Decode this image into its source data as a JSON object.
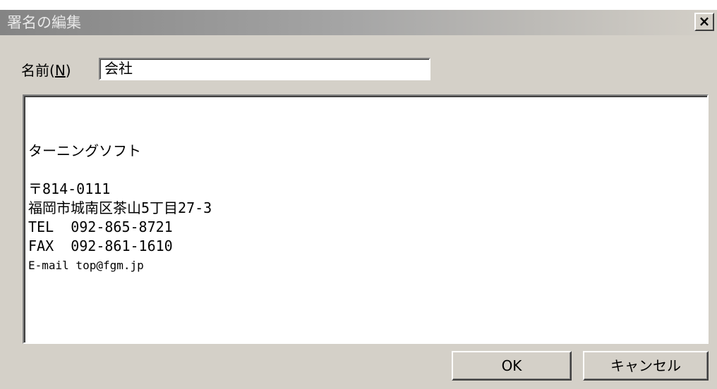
{
  "window": {
    "title": "署名の編集",
    "close_glyph": "×"
  },
  "name_field": {
    "label": "名前(N)",
    "label_prefix": "名前(",
    "label_accel": "N",
    "label_suffix": ")",
    "value": "会社"
  },
  "signature": {
    "lines": [
      "",
      "ターニングソフト",
      "",
      "〒814-0111",
      "福岡市城南区茶山5丁目27-3",
      "TEL  092-865-8721",
      "FAX  092-861-1610",
      "E-mail top@fgm.jp"
    ]
  },
  "buttons": {
    "ok_label": "OK",
    "cancel_label": "キャンセル"
  },
  "colors": {
    "dialog_bg": "#d4d0c8",
    "title_gradient_start": "#848484",
    "title_text": "#e8e8e8",
    "field_bg": "#ffffff"
  }
}
